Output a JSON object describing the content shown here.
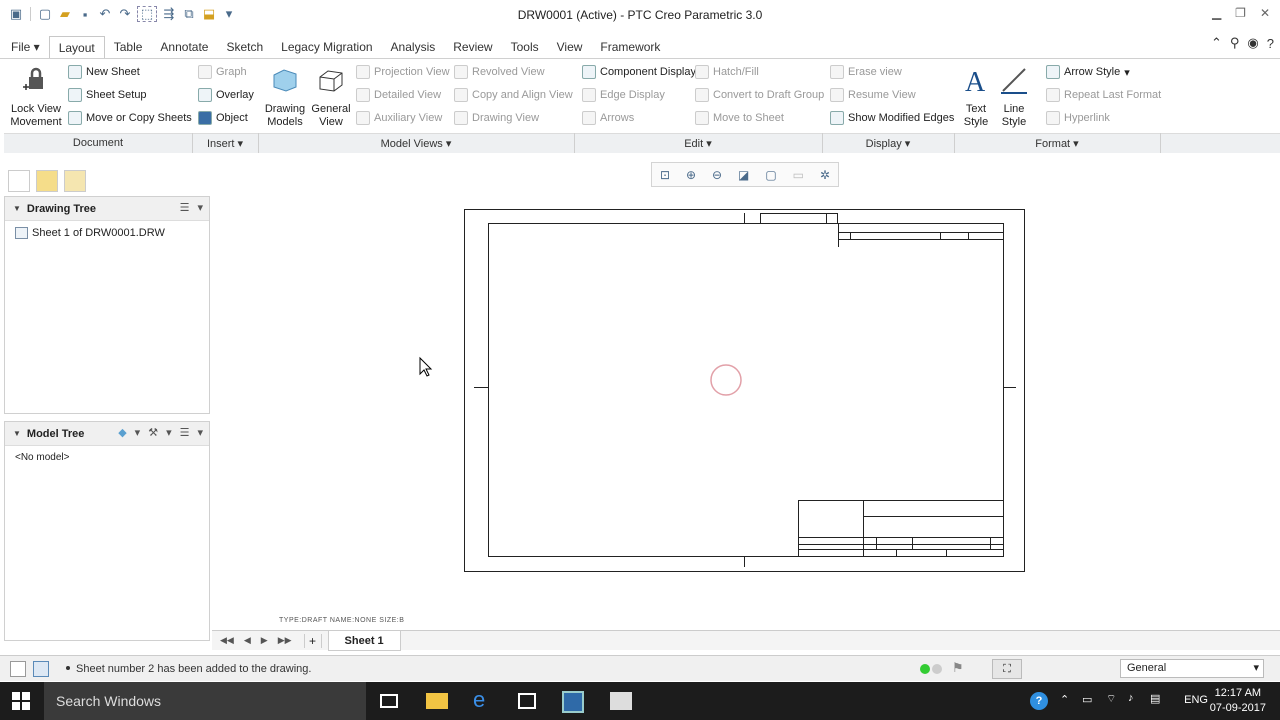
{
  "window": {
    "title": "DRW0001 (Active) - PTC Creo Parametric 3.0"
  },
  "tabs": [
    "File",
    "Layout",
    "Table",
    "Annotate",
    "Sketch",
    "Legacy Migration",
    "Analysis",
    "Review",
    "Tools",
    "View",
    "Framework"
  ],
  "ribbon": {
    "document": {
      "lock_view_1": "Lock View",
      "lock_view_2": "Movement",
      "new_sheet": "New Sheet",
      "sheet_setup": "Sheet Setup",
      "move_copy": "Move or Copy Sheets",
      "group": "Document"
    },
    "insert": {
      "graph": "Graph",
      "overlay": "Overlay",
      "object": "Object",
      "drawing_models_1": "Drawing",
      "drawing_models_2": "Models",
      "general_view_1": "General",
      "general_view_2": "View",
      "group": "Insert"
    },
    "model_views": {
      "projection": "Projection View",
      "detailed": "Detailed View",
      "auxiliary": "Auxiliary View",
      "revolved": "Revolved View",
      "copy_align": "Copy and Align View",
      "drawing_view": "Drawing View",
      "group": "Model Views"
    },
    "edit": {
      "component_display": "Component Display",
      "edge_display": "Edge Display",
      "arrows": "Arrows",
      "hatch_fill": "Hatch/Fill",
      "convert": "Convert to Draft Group",
      "move_to_sheet": "Move to Sheet",
      "group": "Edit"
    },
    "display": {
      "erase_view": "Erase view",
      "resume_view": "Resume View",
      "show_modified": "Show Modified Edges",
      "group": "Display"
    },
    "format": {
      "text_style_1": "Text",
      "text_style_2": "Style",
      "line_style_1": "Line",
      "line_style_2": "Style",
      "arrow_style": "Arrow Style",
      "repeat_last": "Repeat Last Format",
      "hyperlink": "Hyperlink",
      "group": "Format"
    }
  },
  "drawing_tree": {
    "title": "Drawing Tree",
    "item": "Sheet 1 of DRW0001.DRW"
  },
  "model_tree": {
    "title": "Model Tree",
    "empty": "<No model>"
  },
  "sheet_info": "TYPE:DRAFT   NAME:NONE   SIZE:B",
  "sheet_tab": "Sheet 1",
  "status": {
    "message": "Sheet number 2 has been added to the drawing.",
    "filter": "General"
  },
  "taskbar": {
    "search": "Search Windows",
    "lang": "ENG",
    "time": "12:17 AM",
    "date": "07-09-2017"
  }
}
